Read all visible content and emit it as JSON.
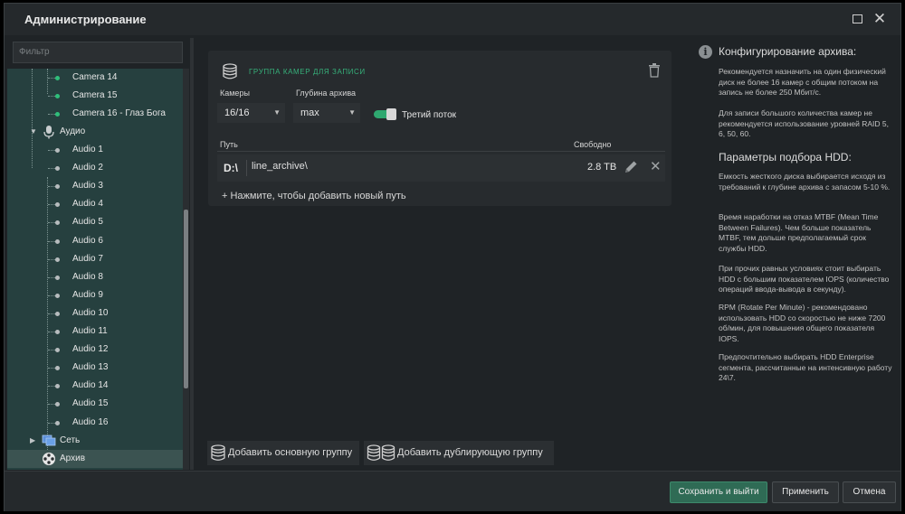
{
  "window": {
    "title": "Администрирование"
  },
  "sidebar": {
    "filter_placeholder": "Фильтр",
    "cameras": [
      "Camera 14",
      "Camera 15",
      "Camera 16 - Глаз Бога"
    ],
    "audio_group": "Аудио",
    "audio": [
      "Audio 1",
      "Audio 2",
      "Audio 3",
      "Audio 4",
      "Audio 5",
      "Audio 6",
      "Audio 7",
      "Audio 8",
      "Audio 9",
      "Audio 10",
      "Audio 11",
      "Audio 12",
      "Audio 13",
      "Audio 14",
      "Audio 15",
      "Audio 16"
    ],
    "network": "Сеть",
    "archive": "Архив"
  },
  "group": {
    "title": "ГРУППА КАМЕР ДЛЯ ЗАПИСИ",
    "cameras_label": "Камеры",
    "cameras_value": "16/16",
    "depth_label": "Глубина архива",
    "depth_value": "max",
    "third_stream_label": "Третий поток",
    "third_stream_on": true,
    "path_header": "Путь",
    "free_header": "Свободно",
    "path": {
      "drive": "D:\\",
      "folder": "line_archive\\",
      "free": "2.8 TB"
    },
    "add_path": "+ Нажмите, чтобы добавить новый путь"
  },
  "actions": {
    "add_main_group": "Добавить основную группу",
    "add_dup_group": "Добавить дублирующую группу"
  },
  "info": {
    "h1": "Конфигурирование архива:",
    "p1": "Рекомендуется назначить на один физический диск не более 16 камер с общим потоком на запись не более 250 Мбит/с.",
    "p2": "Для записи большого количества камер не рекомендуется использование уровней RAID 5, 6, 50, 60.",
    "h2": "Параметры подбора HDD:",
    "p3": "Емкость жесткого диска выбирается исходя из требований к глубине архива с запасом 5-10 %.",
    "p4": "Время наработки на отказ MTBF (Mean Time Between Failures). Чем больше показатель MTBF, тем дольше предполагаемый срок службы HDD.",
    "p5": "При прочих равных условиях стоит выбирать HDD с большим показателем IOPS (количество операций ввода-вывода в секунду).",
    "p6": "RPM (Rotate Per Minute) - рекомендовано использовать HDD со скоростью не ниже 7200 об/мин, для повышения общего показателя IOPS.",
    "p7": "Предпочтительно выбирать HDD Enterprise сегмента, рассчитанные на интенсивную работу 24\\7."
  },
  "footer": {
    "save_exit": "Сохранить и выйти",
    "apply": "Применить",
    "cancel": "Отмена"
  },
  "colors": {
    "accent": "#2fa870",
    "tree_bg": "#26403f",
    "selected_row": "#3b5351"
  }
}
